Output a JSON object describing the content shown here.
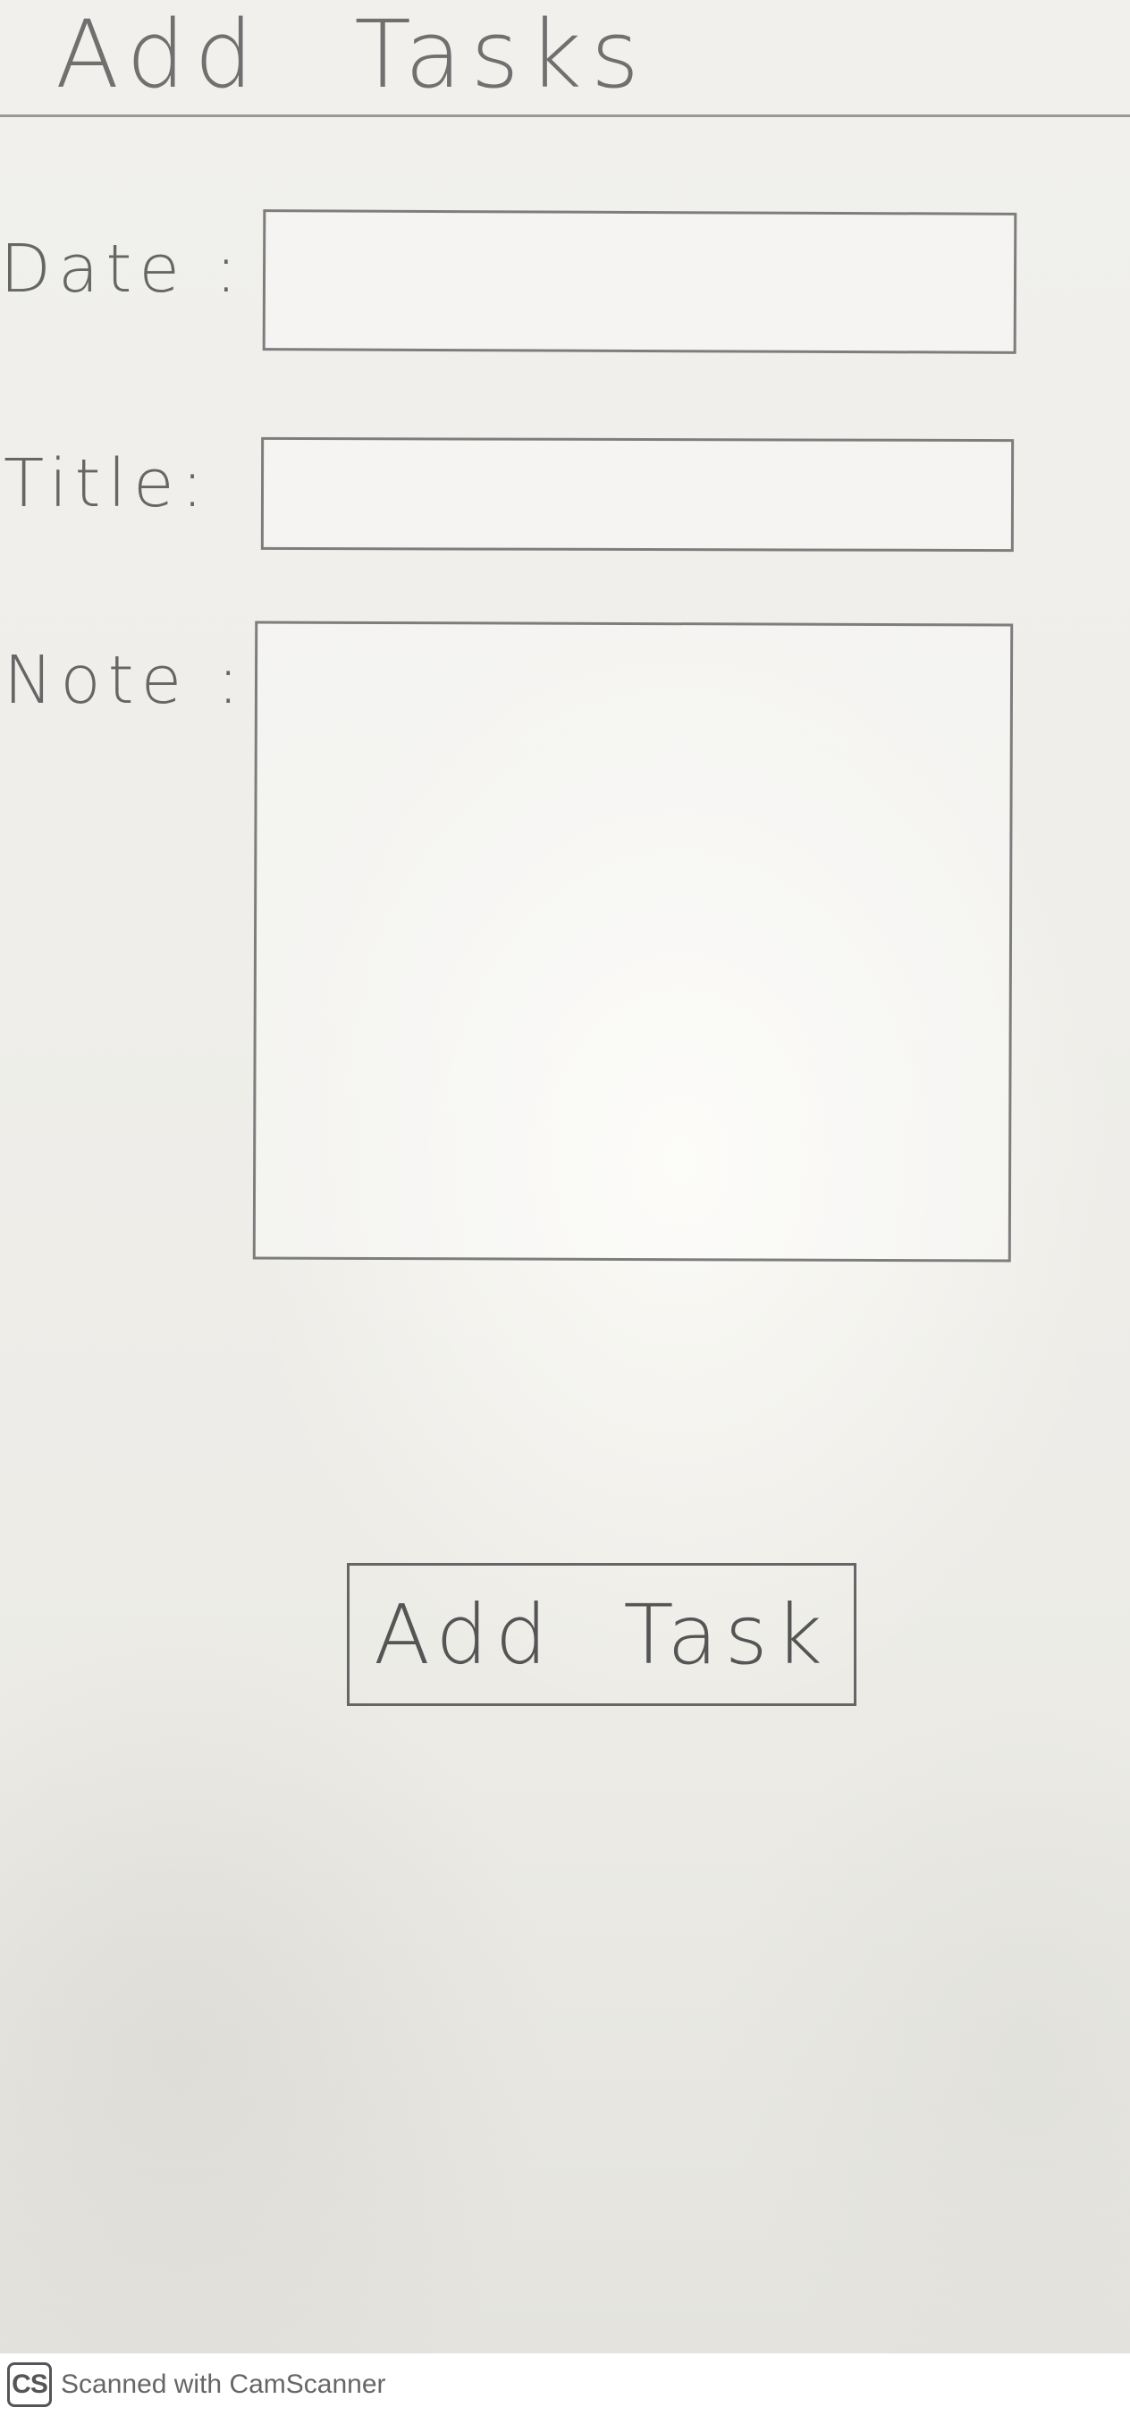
{
  "header": {
    "title": "Add    Tasks"
  },
  "form": {
    "date_label": "Date :",
    "title_label": "Title:",
    "note_label": "Note :",
    "submit_label": "Add  Task"
  },
  "footer": {
    "logo_text": "CS",
    "text": "Scanned with CamScanner"
  }
}
